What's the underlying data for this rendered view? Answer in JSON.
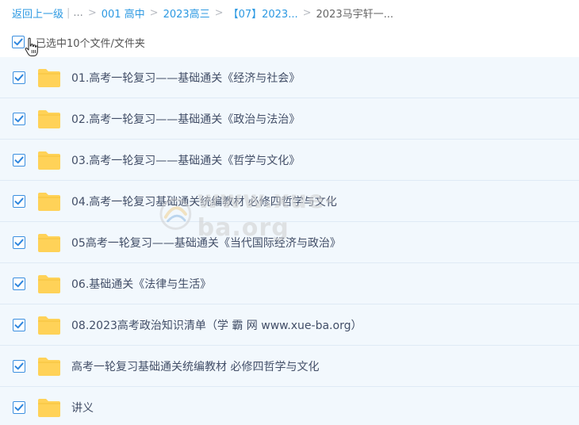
{
  "breadcrumb": {
    "back_label": "返回上一级",
    "ellipsis": "...",
    "items": [
      "001 高中",
      "2023高三",
      "【07】2023...",
      "2023马宇轩一..."
    ]
  },
  "selection": {
    "summary": "已选中10个文件/文件夹",
    "checked": true
  },
  "files": [
    {
      "name": "01.高考一轮复习——基础通关《经济与社会》",
      "type": "folder",
      "checked": true
    },
    {
      "name": "02.高考一轮复习——基础通关《政治与法治》",
      "type": "folder",
      "checked": true
    },
    {
      "name": "03.高考一轮复习——基础通关《哲学与文化》",
      "type": "folder",
      "checked": true
    },
    {
      "name": "04.高考一轮复习基础通关统编教材 必修四哲学与文化",
      "type": "folder",
      "checked": true
    },
    {
      "name": "05高考一轮复习——基础通关《当代国际经济与政治》",
      "type": "folder",
      "checked": true
    },
    {
      "name": "06.基础通关《法律与生活》",
      "type": "folder",
      "checked": true
    },
    {
      "name": "08.2023高考政治知识清单（学 霸 网 www.xue-ba.org）",
      "type": "folder",
      "checked": true
    },
    {
      "name": "高考一轮复习基础通关统编教材 必修四哲学与文化",
      "type": "folder",
      "checked": true
    },
    {
      "name": "讲义",
      "type": "folder",
      "checked": true
    }
  ],
  "watermark": {
    "text": "www.xue-ba.org"
  },
  "colors": {
    "link": "#2c99e2",
    "checkbox": "#3b8fe0",
    "row_bg": "#f2f8fd",
    "folder": "#ffd258"
  },
  "icons": {
    "checkbox": "check-icon",
    "folder": "folder-icon",
    "cursor": "hand-pointer-icon",
    "watermark": "watermark-logo-icon"
  }
}
